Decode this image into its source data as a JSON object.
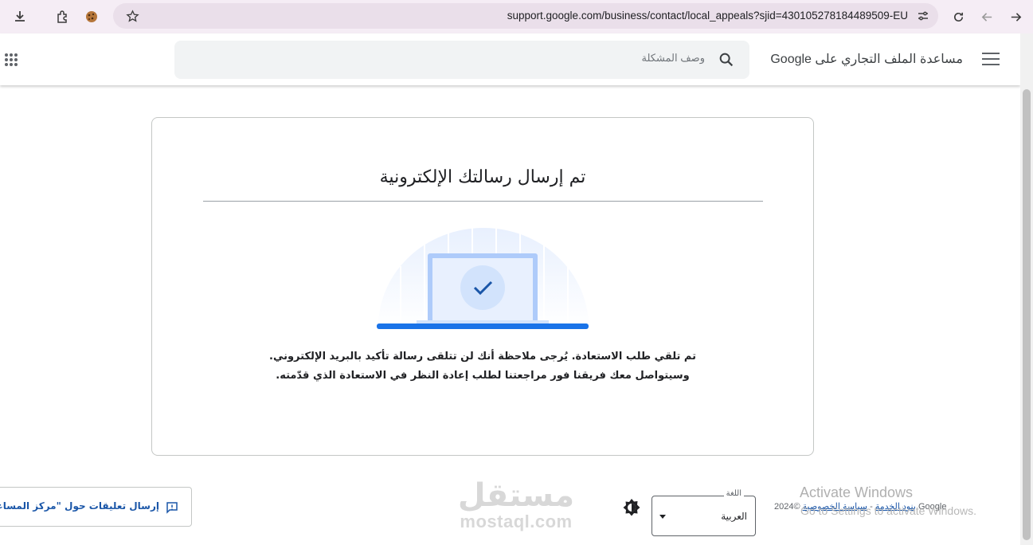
{
  "browser": {
    "url": "support.google.com/business/contact/local_appeals?sjid=430105278184489509-EU",
    "icons": [
      "download-icon",
      "extensions-icon",
      "cookie-icon",
      "bookmark-star-icon",
      "site-settings-icon",
      "reload-icon",
      "back-icon",
      "forward-icon"
    ]
  },
  "header": {
    "product_title": "مساعدة الملف التجاري على Google",
    "search_placeholder": "وصف المشكلة"
  },
  "card": {
    "title": "تم إرسال رسالتك الإلكترونية",
    "message_line1": "تم تلقي طلب الاستعادة. يُرجى ملاحظة أنك لن تتلقى رسالة تأكيد بالبريد الإلكتروني.",
    "message_line2": "وسيتواصل معك فريقنا فور مراجعتنا لطلب إعادة النظر في الاستعادة الذي قدّمته."
  },
  "footer": {
    "feedback_label": "إرسال تعليقات حول \"مركز المساعدة\"",
    "language_legend": "اللغة",
    "language_value": "العربية",
    "copyright": "©2024 Google",
    "privacy_link": "سياسة الخصوصية",
    "terms_link": "بنود الخدمة",
    "separator": "-"
  },
  "watermark": {
    "arabic": "مستقل",
    "latin": "mostaql.com"
  },
  "os_overlay": {
    "title": "Activate Windows",
    "subtitle": "Go to Settings to activate Windows."
  },
  "colors": {
    "accent": "#1a73e8",
    "link": "#1a56a8",
    "browser_bar": "#f5edf5"
  }
}
